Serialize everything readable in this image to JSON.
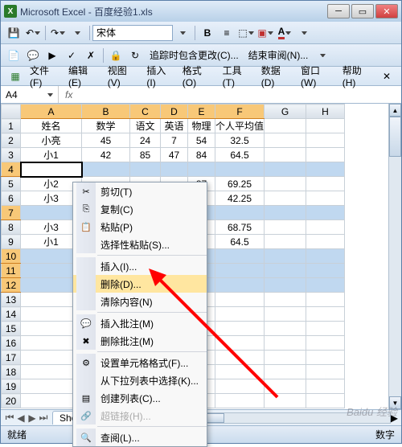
{
  "titlebar": {
    "app": "Microsoft Excel",
    "doc": "百度经验1.xls"
  },
  "toolbar1": {
    "font": "宋体"
  },
  "toolbar2": {
    "trace": "追踪时包含更改(C)...",
    "endreview": "结束审阅(N)..."
  },
  "menu": {
    "file": "文件(F)",
    "edit": "编辑(E)",
    "view": "视图(V)",
    "insert": "插入(I)",
    "format": "格式(O)",
    "tools": "工具(T)",
    "data": "数据(D)",
    "window": "窗口(W)",
    "help": "帮助(H)"
  },
  "namebox": "A4",
  "fxlabel": "fx",
  "columns": [
    "A",
    "B",
    "C",
    "D",
    "E",
    "F",
    "G",
    "H"
  ],
  "rownums": [
    "1",
    "2",
    "3",
    "4",
    "5",
    "6",
    "7",
    "8",
    "9",
    "10",
    "11",
    "12",
    "13",
    "14",
    "15",
    "16",
    "17",
    "18",
    "19",
    "20"
  ],
  "headers": {
    "name": "姓名",
    "math": "数学",
    "chinese": "语文",
    "english": "英语",
    "physics": "物理",
    "avg": "个人平均值"
  },
  "chart_data": {
    "type": "table",
    "columns": [
      "姓名",
      "数学",
      "语文",
      "英语",
      "物理",
      "个人平均值"
    ],
    "rows": [
      [
        "小亮",
        45,
        24,
        7,
        54,
        32.5
      ],
      [
        "小1",
        42,
        85,
        47,
        84,
        64.5
      ],
      [
        "",
        "",
        "",
        "",
        "",
        ""
      ],
      [
        "小2",
        "",
        "",
        "",
        87,
        69.25
      ],
      [
        "小3",
        "",
        "",
        "",
        54,
        42.25
      ],
      [
        "",
        "",
        "",
        "",
        "",
        ""
      ],
      [
        "小3",
        "",
        "",
        "",
        87,
        68.75
      ],
      [
        "小1",
        "",
        "",
        "",
        84,
        64.5
      ]
    ]
  },
  "cells": {
    "r2": {
      "a": "小亮",
      "b": "45",
      "c": "24",
      "d": "7",
      "e": "54",
      "f": "32.5"
    },
    "r3": {
      "a": "小1",
      "b": "42",
      "c": "85",
      "d": "47",
      "e": "84",
      "f": "64.5"
    },
    "r5": {
      "a": "小2",
      "e": "87",
      "f": "69.25"
    },
    "r6": {
      "a": "小3",
      "e": "54",
      "f": "42.25"
    },
    "r8": {
      "a": "小3",
      "e": "87",
      "f": "68.75"
    },
    "r9": {
      "a": "小1",
      "e": "84",
      "f": "64.5"
    }
  },
  "ctxmenu": {
    "cut": "剪切(T)",
    "copy": "复制(C)",
    "paste": "粘贴(P)",
    "paste_special": "选择性粘贴(S)...",
    "insert": "插入(I)...",
    "delete": "删除(D)...",
    "clear": "清除内容(N)",
    "insert_comment": "插入批注(M)",
    "delete_comment": "删除批注(M)",
    "format_cells": "设置单元格格式(F)...",
    "dropdown": "从下拉列表中选择(K)...",
    "create_list": "创建列表(C)...",
    "hyperlink": "超链接(H)...",
    "lookup": "查阅(L)..."
  },
  "tabs": {
    "sheet": "Shee"
  },
  "status": {
    "ready": "就绪",
    "numlock": "数字"
  },
  "watermark": "Baidu 经验"
}
